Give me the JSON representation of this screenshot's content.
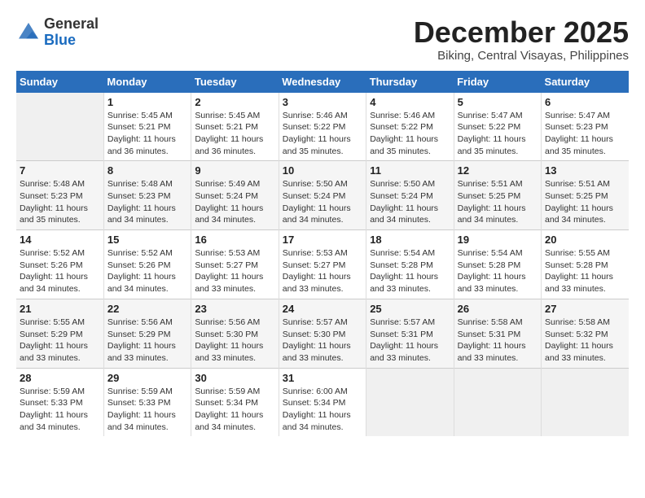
{
  "header": {
    "logo_general": "General",
    "logo_blue": "Blue",
    "month_title": "December 2025",
    "subtitle": "Biking, Central Visayas, Philippines"
  },
  "weekdays": [
    "Sunday",
    "Monday",
    "Tuesday",
    "Wednesday",
    "Thursday",
    "Friday",
    "Saturday"
  ],
  "weeks": [
    [
      {
        "day": "",
        "info": ""
      },
      {
        "day": "1",
        "info": "Sunrise: 5:45 AM\nSunset: 5:21 PM\nDaylight: 11 hours and 36 minutes."
      },
      {
        "day": "2",
        "info": "Sunrise: 5:45 AM\nSunset: 5:21 PM\nDaylight: 11 hours and 36 minutes."
      },
      {
        "day": "3",
        "info": "Sunrise: 5:46 AM\nSunset: 5:22 PM\nDaylight: 11 hours and 35 minutes."
      },
      {
        "day": "4",
        "info": "Sunrise: 5:46 AM\nSunset: 5:22 PM\nDaylight: 11 hours and 35 minutes."
      },
      {
        "day": "5",
        "info": "Sunrise: 5:47 AM\nSunset: 5:22 PM\nDaylight: 11 hours and 35 minutes."
      },
      {
        "day": "6",
        "info": "Sunrise: 5:47 AM\nSunset: 5:23 PM\nDaylight: 11 hours and 35 minutes."
      }
    ],
    [
      {
        "day": "7",
        "info": "Sunrise: 5:48 AM\nSunset: 5:23 PM\nDaylight: 11 hours and 35 minutes."
      },
      {
        "day": "8",
        "info": "Sunrise: 5:48 AM\nSunset: 5:23 PM\nDaylight: 11 hours and 34 minutes."
      },
      {
        "day": "9",
        "info": "Sunrise: 5:49 AM\nSunset: 5:24 PM\nDaylight: 11 hours and 34 minutes."
      },
      {
        "day": "10",
        "info": "Sunrise: 5:50 AM\nSunset: 5:24 PM\nDaylight: 11 hours and 34 minutes."
      },
      {
        "day": "11",
        "info": "Sunrise: 5:50 AM\nSunset: 5:24 PM\nDaylight: 11 hours and 34 minutes."
      },
      {
        "day": "12",
        "info": "Sunrise: 5:51 AM\nSunset: 5:25 PM\nDaylight: 11 hours and 34 minutes."
      },
      {
        "day": "13",
        "info": "Sunrise: 5:51 AM\nSunset: 5:25 PM\nDaylight: 11 hours and 34 minutes."
      }
    ],
    [
      {
        "day": "14",
        "info": "Sunrise: 5:52 AM\nSunset: 5:26 PM\nDaylight: 11 hours and 34 minutes."
      },
      {
        "day": "15",
        "info": "Sunrise: 5:52 AM\nSunset: 5:26 PM\nDaylight: 11 hours and 34 minutes."
      },
      {
        "day": "16",
        "info": "Sunrise: 5:53 AM\nSunset: 5:27 PM\nDaylight: 11 hours and 33 minutes."
      },
      {
        "day": "17",
        "info": "Sunrise: 5:53 AM\nSunset: 5:27 PM\nDaylight: 11 hours and 33 minutes."
      },
      {
        "day": "18",
        "info": "Sunrise: 5:54 AM\nSunset: 5:28 PM\nDaylight: 11 hours and 33 minutes."
      },
      {
        "day": "19",
        "info": "Sunrise: 5:54 AM\nSunset: 5:28 PM\nDaylight: 11 hours and 33 minutes."
      },
      {
        "day": "20",
        "info": "Sunrise: 5:55 AM\nSunset: 5:28 PM\nDaylight: 11 hours and 33 minutes."
      }
    ],
    [
      {
        "day": "21",
        "info": "Sunrise: 5:55 AM\nSunset: 5:29 PM\nDaylight: 11 hours and 33 minutes."
      },
      {
        "day": "22",
        "info": "Sunrise: 5:56 AM\nSunset: 5:29 PM\nDaylight: 11 hours and 33 minutes."
      },
      {
        "day": "23",
        "info": "Sunrise: 5:56 AM\nSunset: 5:30 PM\nDaylight: 11 hours and 33 minutes."
      },
      {
        "day": "24",
        "info": "Sunrise: 5:57 AM\nSunset: 5:30 PM\nDaylight: 11 hours and 33 minutes."
      },
      {
        "day": "25",
        "info": "Sunrise: 5:57 AM\nSunset: 5:31 PM\nDaylight: 11 hours and 33 minutes."
      },
      {
        "day": "26",
        "info": "Sunrise: 5:58 AM\nSunset: 5:31 PM\nDaylight: 11 hours and 33 minutes."
      },
      {
        "day": "27",
        "info": "Sunrise: 5:58 AM\nSunset: 5:32 PM\nDaylight: 11 hours and 33 minutes."
      }
    ],
    [
      {
        "day": "28",
        "info": "Sunrise: 5:59 AM\nSunset: 5:33 PM\nDaylight: 11 hours and 34 minutes."
      },
      {
        "day": "29",
        "info": "Sunrise: 5:59 AM\nSunset: 5:33 PM\nDaylight: 11 hours and 34 minutes."
      },
      {
        "day": "30",
        "info": "Sunrise: 5:59 AM\nSunset: 5:34 PM\nDaylight: 11 hours and 34 minutes."
      },
      {
        "day": "31",
        "info": "Sunrise: 6:00 AM\nSunset: 5:34 PM\nDaylight: 11 hours and 34 minutes."
      },
      {
        "day": "",
        "info": ""
      },
      {
        "day": "",
        "info": ""
      },
      {
        "day": "",
        "info": ""
      }
    ]
  ]
}
